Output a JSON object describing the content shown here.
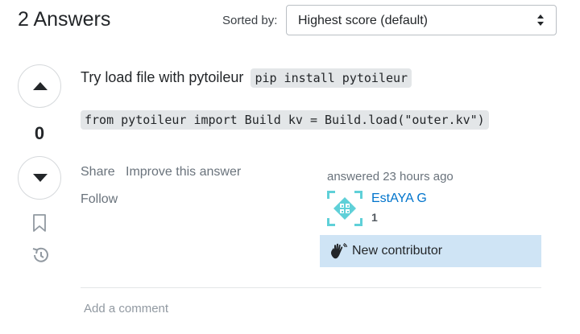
{
  "header": {
    "answers_title": "2 Answers",
    "sorted_label": "Sorted by:",
    "sort_value": "Highest score (default)"
  },
  "vote": {
    "count": "0"
  },
  "post": {
    "text": "Try load file with pytoileur",
    "inline_code": "pip install pytoileur",
    "code_block": "from pytoileur import Build kv = Build.load(\"outer.kv\")"
  },
  "actions": {
    "share": "Share",
    "improve": "Improve this answer",
    "follow": "Follow"
  },
  "user": {
    "answered": "answered 23 hours ago",
    "name": "EstAYA G",
    "reputation": "1",
    "new_contributor": "New contributor",
    "link_color": "#0074cc",
    "badge_bg": "#cfe4f5"
  },
  "comments": {
    "add_comment": "Add a comment"
  },
  "icons": {
    "upvote": "arrow-up-icon",
    "downvote": "arrow-down-icon",
    "bookmark": "bookmark-icon",
    "history": "history-icon",
    "sort_caret": "select-caret-icon",
    "wave": "waving-hand-icon",
    "avatar": "identicon-avatar"
  }
}
